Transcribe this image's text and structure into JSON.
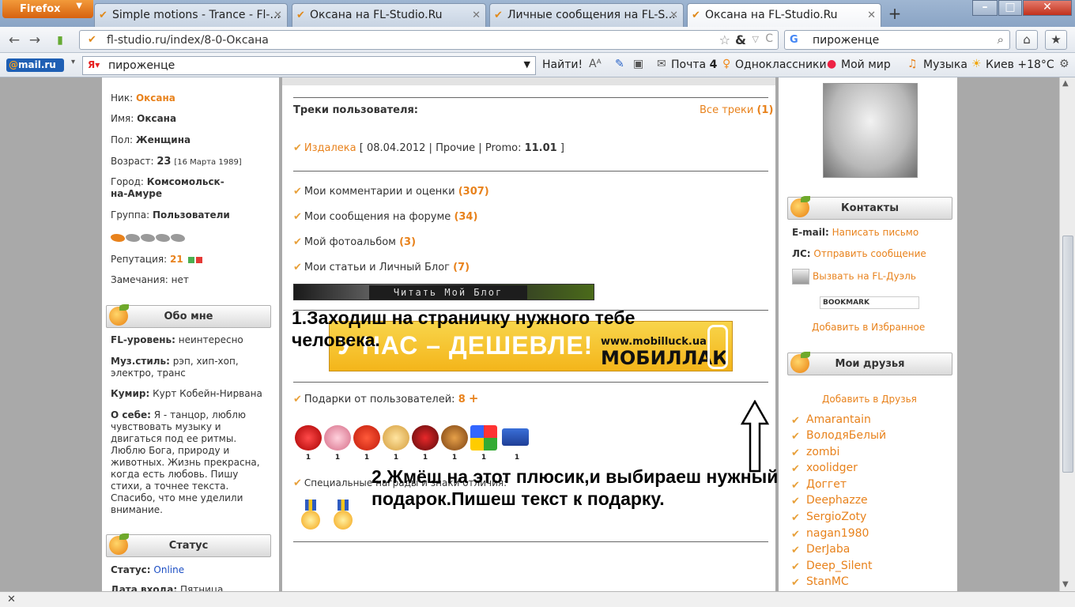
{
  "browser": {
    "app_button": "Firefox",
    "tabs": [
      {
        "title": "Simple motions - Trance - Fl-..."
      },
      {
        "title": "Оксана на FL-Studio.Ru"
      },
      {
        "title": "Личные сообщения на FL-S..."
      },
      {
        "title": "Оксана на FL-Studio.Ru"
      }
    ],
    "url": "fl-studio.ru/index/8-0-Оксана",
    "search_query": "пироженце"
  },
  "mailbar": {
    "logo": "mail.ru",
    "search_value": "пироженце",
    "find_label": "Найти!",
    "mail_label": "Почта",
    "mail_count": "4",
    "ok_label": "Одноклассники",
    "myworld_label": "Мой мир",
    "music_label": "Музыка",
    "weather_label": "Киев +18°C"
  },
  "profile": {
    "nick_label": "Ник:",
    "nick": "Оксана",
    "name_label": "Имя:",
    "name": "Оксана",
    "sex_label": "Пол:",
    "sex": "Женщина",
    "age_label": "Возраст:",
    "age": "23",
    "birthday": "[16 Марта 1989]",
    "city_label": "Город:",
    "city_line1": "Комсомольск-",
    "city_line2": "на-Амуре",
    "group_label": "Группа:",
    "group": "Пользователи",
    "rep_label": "Репутация:",
    "rep": "21",
    "remarks_label": "Замечания:",
    "remarks": "нет"
  },
  "about": {
    "title": "Обо мне",
    "fl_label": "FL-уровень:",
    "fl_value": "неинтересно",
    "style_label": "Муз.стиль:",
    "style_line1": "рэп, хип-хоп,",
    "style_line2": "электро, транс",
    "idol_label": "Кумир:",
    "idol": "Курт Кобейн-Нирвана",
    "self_label": "О себе:",
    "self_lines": [
      "Я - танцор, люблю",
      "чувствовать музыку и",
      "двигаться под ее ритмы.",
      "Люблю Бога, природу и",
      "животных. Жизнь прекрасна,",
      "когда есть любовь. Пишу",
      "стихи, а точнее текста.",
      "Спасибо, что мне уделили",
      "внимание."
    ]
  },
  "status": {
    "title": "Статус",
    "status_label": "Статус:",
    "status_value": "Online",
    "last_label": "Дата входа:",
    "last_value": "Пятница"
  },
  "main": {
    "tracks_title": "Треки пользователя:",
    "all_tracks": "Все треки",
    "all_tracks_count": "(1)",
    "track_name": "Издалека",
    "track_date": "08.04.2012",
    "track_genre": "Прочие",
    "promo_label": "Promo:",
    "promo_value": "11.01",
    "links": [
      {
        "label": "Мои комментарии и оценки",
        "count": "(307)"
      },
      {
        "label": "Мои сообщения на форуме",
        "count": "(34)"
      },
      {
        "label": "Мой фотоальбом",
        "count": "(3)"
      },
      {
        "label": "Мои статьи и Личный Блог",
        "count": "(7)"
      }
    ],
    "blog_button": "Читать Мой Блог",
    "banner_text": "У НАС – ДЕШЕВЛЕ!",
    "banner_url": "www.mobilluck.ua",
    "banner_brand": "МОБИЛЛАК",
    "gifts_label": "Подарки от пользователей:",
    "gifts_count": "8",
    "gifts_plus": "+",
    "gift_counts": [
      "1",
      "1",
      "1",
      "1",
      "1",
      "1",
      "1",
      "1"
    ],
    "awards_label": "Специальные награды и знаки отличия:"
  },
  "annotations": {
    "step1_line1": "1.Заходиш на страничку нужного тебе",
    "step1_line2": "человека.",
    "step2_line1": "2.Жмёш на этот плюсик,и выбираеш нужный",
    "step2_line2": "подарок.Пишеш текст к подарку."
  },
  "contacts": {
    "title": "Контакты",
    "email_label": "E-mail:",
    "email_link": "Написать письмо",
    "pm_label": "ЛС:",
    "pm_link": "Отправить сообщение",
    "duel_link": "Вызвать на FL-Дуэль",
    "bookmark": "BOOKMARK",
    "favorites_link": "Добавить в Избранное"
  },
  "friends": {
    "title": "Мои друзья",
    "add_link": "Добавить в Друзья",
    "list": [
      "Amarantain",
      "ВолодяБелый",
      "zombi",
      "xoolidger",
      "Доггет",
      "Deephazze",
      "SergioZoty",
      "nagan1980",
      "DerJaba",
      "Deep_Silent",
      "StanMC"
    ]
  },
  "colors": {
    "accent": "#e8821c",
    "online": "#1d4fc4"
  }
}
